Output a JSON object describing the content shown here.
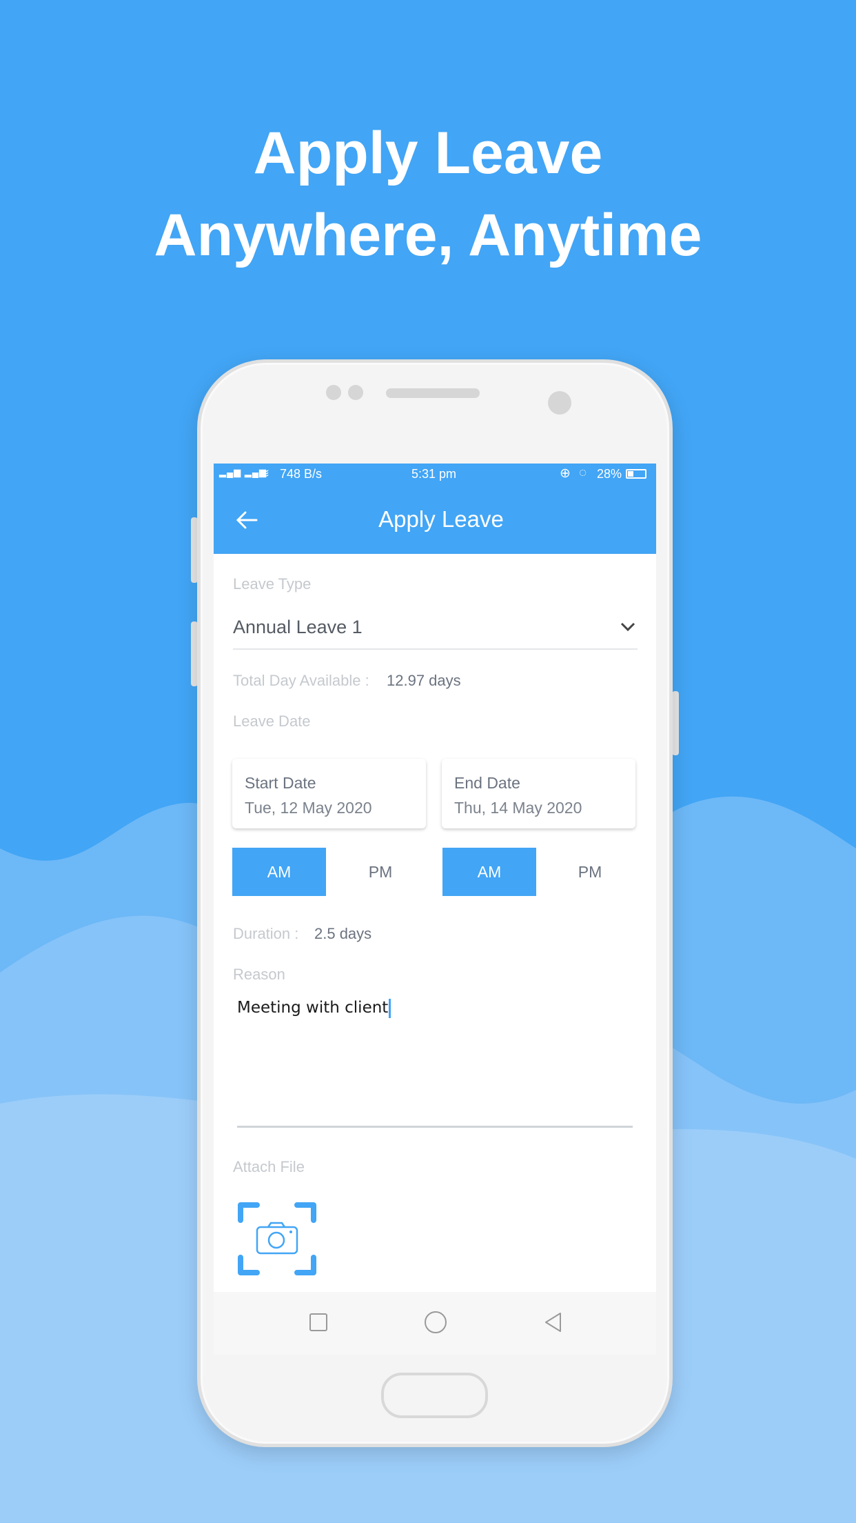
{
  "headline": {
    "line1": "Apply Leave",
    "line2": "Anywhere, Anytime"
  },
  "colors": {
    "accent": "#42a5f5",
    "background_top": "#42a5f5",
    "background_wave": "#9ccdf9"
  },
  "status_bar": {
    "network_speed": "748 B/s",
    "time": "5:31 pm",
    "battery": "28%",
    "signal_labels": [
      "3G",
      "4G"
    ]
  },
  "app_bar": {
    "title": "Apply Leave",
    "back_icon": "arrow-left-icon"
  },
  "form": {
    "leave_type_label": "Leave Type",
    "leave_type_value": "Annual Leave 1",
    "total_day_label": "Total Day Available :",
    "total_day_value": "12.97 days",
    "leave_date_label": "Leave Date",
    "start_date": {
      "label": "Start Date",
      "value": "Tue, 12 May 2020",
      "am": "AM",
      "pm": "PM",
      "selected": "AM"
    },
    "end_date": {
      "label": "End Date",
      "value": "Thu, 14 May 2020",
      "am": "AM",
      "pm": "PM",
      "selected": "AM"
    },
    "duration_label": "Duration :",
    "duration_value": "2.5 days",
    "reason_label": "Reason",
    "reason_value": "Meeting with client",
    "attach_label": "Attach File",
    "attach_icon": "camera-icon"
  },
  "nav_bar": {
    "icons": [
      "square-recents-icon",
      "circle-home-icon",
      "triangle-back-icon"
    ]
  }
}
